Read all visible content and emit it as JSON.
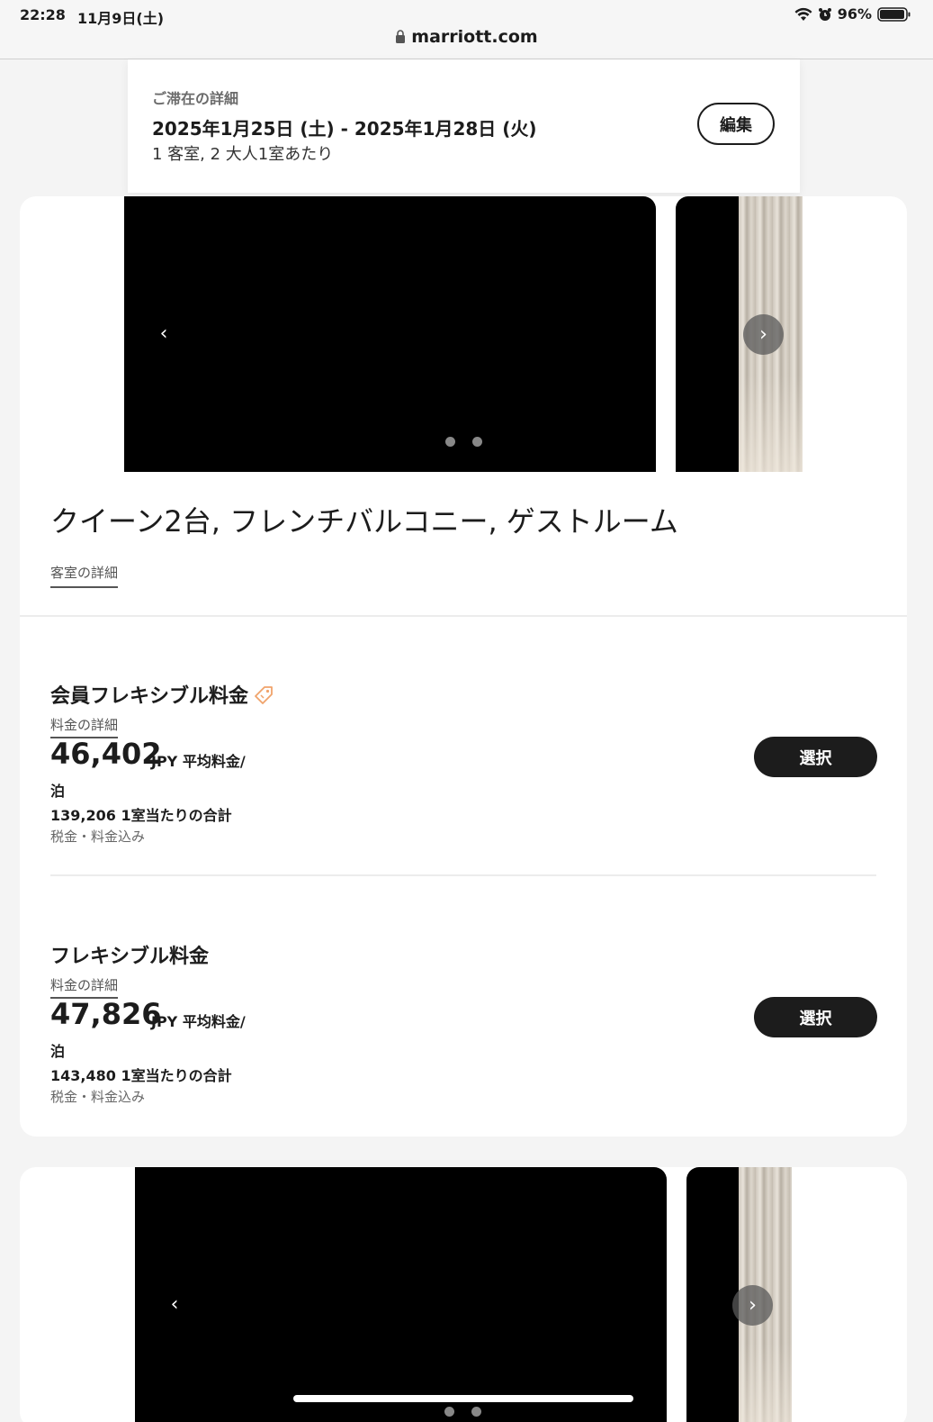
{
  "status_bar": {
    "time": "22:28",
    "date": "11月9日(土)",
    "battery": "96%"
  },
  "browser": {
    "url": "marriott.com"
  },
  "stay": {
    "label": "ご滞在の詳細",
    "dates": "2025年1月25日 (土) - 2025年1月28日 (火)",
    "guests": "1 客室, 2 大人1室あたり",
    "edit_label": "編集"
  },
  "rooms": [
    {
      "title": "クイーン2台, フレンチバルコニー, ゲストルーム",
      "details_link": "客室の詳細",
      "rates": [
        {
          "name": "会員フレキシブル料金",
          "has_member_tag": true,
          "details_link": "料金の詳細",
          "price": "46,402",
          "price_unit": "JPY 平均料金/",
          "price_per": "泊",
          "total": "139,206 1室当たりの合計",
          "tax_note": "税金・料金込み",
          "select_label": "選択"
        },
        {
          "name": "フレキシブル料金",
          "has_member_tag": false,
          "details_link": "料金の詳細",
          "price": "47,826",
          "price_unit": "JPY 平均料金/",
          "price_per": "泊",
          "total": "143,480 1室当たりの合計",
          "tax_note": "税金・料金込み",
          "select_label": "選択"
        }
      ]
    }
  ],
  "icons": {
    "left_arrow": "‹",
    "right_arrow": "›"
  },
  "colors": {
    "accent_tag": "#f0a36b",
    "button": "#1c1c1c"
  }
}
